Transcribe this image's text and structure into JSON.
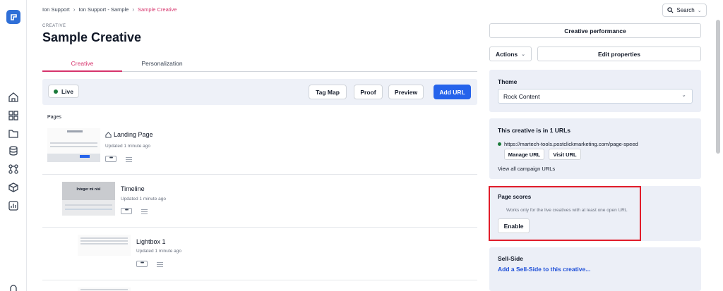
{
  "breadcrumb": [
    "Ion Support",
    "Ion Support - Sample",
    "Sample Creative"
  ],
  "kicker": "CREATIVE",
  "title": "Sample Creative",
  "search_label": "Search",
  "tabs": [
    {
      "label": "Creative",
      "active": true
    },
    {
      "label": "Personalization",
      "active": false
    }
  ],
  "toolbar": {
    "status": "Live",
    "buttons": [
      "Tag Map",
      "Proof",
      "Preview",
      "Add URL"
    ]
  },
  "pages_label": "Pages",
  "pages": [
    {
      "name": "Landing Page",
      "updated": "Updated 1 minute ago",
      "thumb_text": ""
    },
    {
      "name": "Timeline",
      "updated": "Updated 1 minute ago",
      "thumb_text": "Integer mi nisl"
    },
    {
      "name": "Lightbox 1",
      "updated": "Updated 1 minute ago",
      "thumb_text": ""
    }
  ],
  "dots": "•••",
  "right": {
    "performance_label": "Creative performance",
    "actions_label": "Actions",
    "edit_label": "Edit properties",
    "theme": {
      "title": "Theme",
      "value": "Rock Content"
    },
    "urls": {
      "title": "This creative is in 1 URLs",
      "url": "https://martech-tools.postclickmarketing.com/page-speed",
      "manage": "Manage URL",
      "visit": "Visit URL",
      "view_all": "View all campaign URLs"
    },
    "page_scores": {
      "title": "Page scores",
      "note": "Works only for the live creatives with at least one open URL",
      "button": "Enable"
    },
    "sell_side": {
      "title": "Sell-Side",
      "link": "Add a Sell-Side to this creative..."
    }
  },
  "colors": {
    "accent": "#d6336c",
    "primary": "#2563eb",
    "live": "#1b7a3a",
    "highlight": "#e11d2a"
  }
}
